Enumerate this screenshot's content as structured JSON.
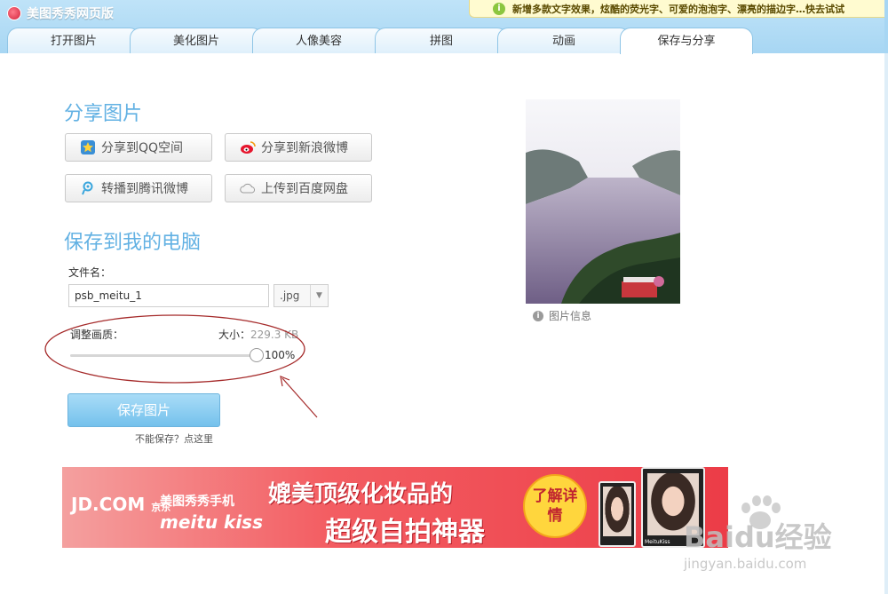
{
  "app": {
    "title": "美图秀秀网页版"
  },
  "notice": {
    "text": "新增多款文字效果，炫酷的荧光字、可爱的泡泡字、漂亮的描边字…快去试试",
    "icon": "info-icon"
  },
  "tabs": [
    {
      "label": "打开图片"
    },
    {
      "label": "美化图片"
    },
    {
      "label": "人像美容"
    },
    {
      "label": "拼图"
    },
    {
      "label": "动画"
    },
    {
      "label": "保存与分享",
      "active": true
    }
  ],
  "share": {
    "title": "分享图片",
    "buttons": [
      {
        "label": "分享到QQ空间",
        "icon": "qzone-star-icon"
      },
      {
        "label": "分享到新浪微博",
        "icon": "weibo-icon"
      },
      {
        "label": "转播到腾讯微博",
        "icon": "tencent-weibo-icon"
      },
      {
        "label": "上传到百度网盘",
        "icon": "cloud-icon"
      }
    ]
  },
  "save": {
    "title": "保存到我的电脑",
    "filename_label": "文件名：",
    "filename_value": "psb_meitu_1",
    "extension": ".jpg",
    "quality_label": "调整画质：",
    "size_label": "大小：",
    "size_value": "229.3 KB",
    "quality_percent": 100,
    "quality_text": "100%",
    "save_button": "保存图片",
    "help_link": "不能保存？点这里"
  },
  "photo": {
    "info_label": "图片信息"
  },
  "banner": {
    "jd_logo": "JD.COM",
    "jd_cn": "京东",
    "brand_cn": "美图秀秀手机",
    "brand_en": "meitu kiss",
    "line1": "媲美顶级化妆品的",
    "line2": "超级自拍神器",
    "cta": "了解详情",
    "phone_label": "MeituKiss"
  },
  "watermark": {
    "text": "Baidu经验",
    "url": "jingyan.baidu.com"
  },
  "colors": {
    "accent": "#62b1e3",
    "annotation": "#a52a2a",
    "banner": "#ec3c47"
  }
}
